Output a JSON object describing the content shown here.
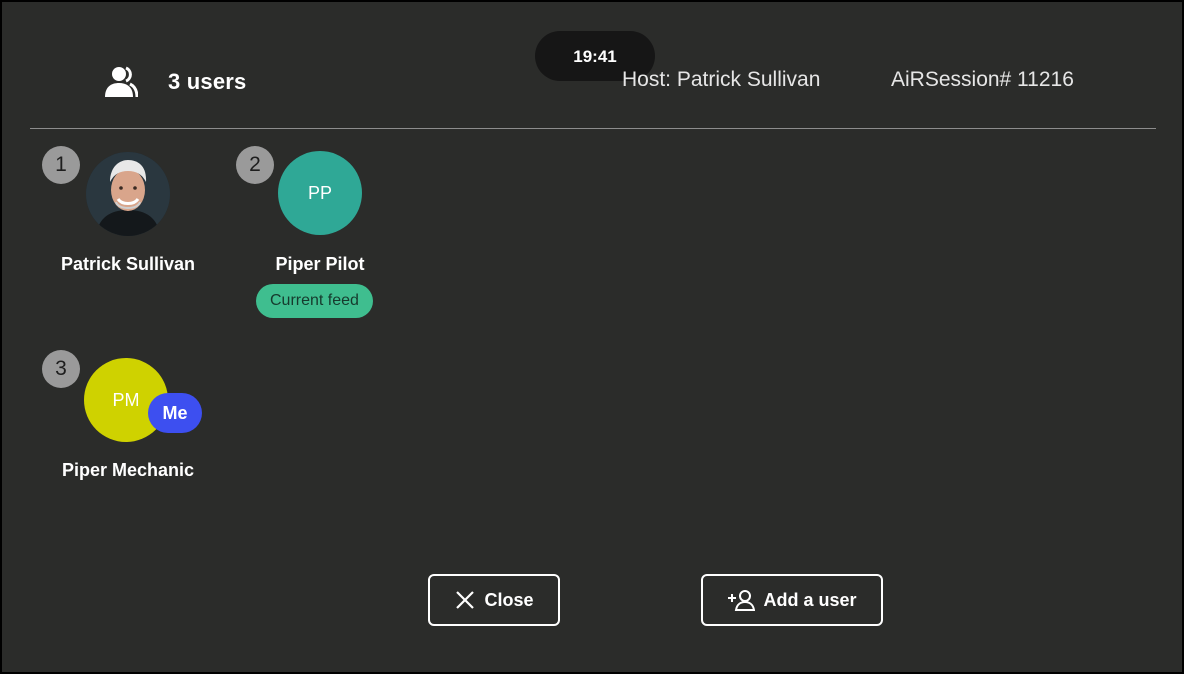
{
  "header": {
    "time": "19:41",
    "users_count_label": "3 users",
    "users_icon": "users-group-icon",
    "host_label": "Host: Patrick Sullivan",
    "session_label": "AiRSession# 11216"
  },
  "users": [
    {
      "index": "1",
      "name": "Patrick Sullivan",
      "avatar_type": "photo"
    },
    {
      "index": "2",
      "name": "Piper Pilot",
      "initials": "PP",
      "avatar_color": "#2fa896",
      "status_badge": "Current feed"
    },
    {
      "index": "3",
      "name": "Piper Mechanic",
      "initials": "PM",
      "avatar_color": "#cfd200",
      "self_badge": "Me"
    }
  ],
  "actions": {
    "close_label": "Close",
    "close_icon": "close-icon",
    "add_user_label": "Add a user",
    "add_user_icon": "add-user-icon"
  },
  "colors": {
    "background": "#2b2c2a",
    "current_feed": "#3fbe8f",
    "me_badge": "#3d4ff0",
    "index_badge": "#9a9a9a"
  }
}
